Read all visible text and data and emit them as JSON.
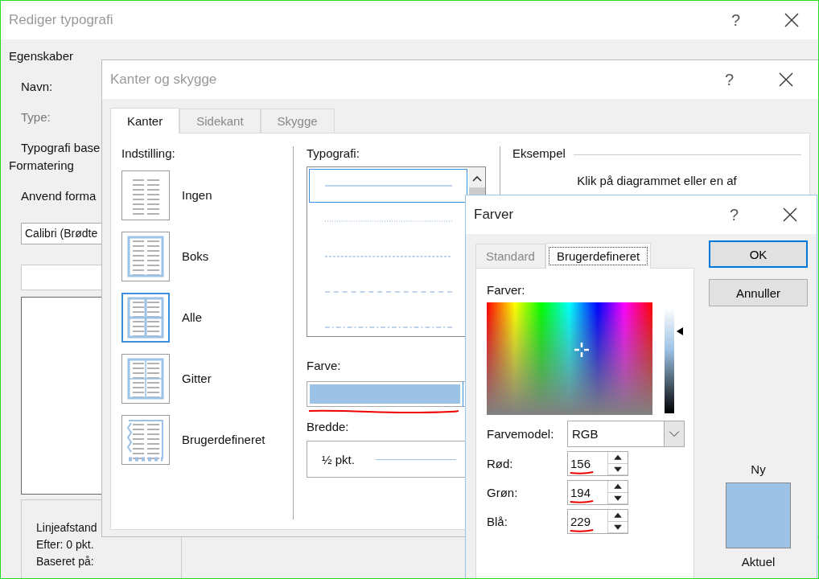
{
  "style_window": {
    "title": "Rediger typografi",
    "help": "?",
    "properties_heading": "Egenskaber",
    "fields": [
      {
        "label": "Navn:",
        "disabled": false
      },
      {
        "label": "Type:",
        "disabled": true
      },
      {
        "label": "Typografi base",
        "disabled": false
      }
    ],
    "formatting_heading": "Formatering",
    "apply_label": "Anvend forma",
    "font_select": "Calibri (Brødte",
    "description_lines": [
      "Linjeafstand",
      "Efter:  0 pkt.",
      "Baseret på:"
    ]
  },
  "borders_window": {
    "title": "Kanter og skygge",
    "help": "?",
    "tabs": [
      {
        "label": "Kanter",
        "selected": true
      },
      {
        "label": "Sidekant",
        "selected": false
      },
      {
        "label": "Skygge",
        "selected": false
      }
    ],
    "setting_heading": "Indstilling:",
    "presets": [
      {
        "kind": "none",
        "label": "Ingen",
        "selected": false
      },
      {
        "kind": "box",
        "label": "Boks",
        "selected": false
      },
      {
        "kind": "all",
        "label": "Alle",
        "selected": true
      },
      {
        "kind": "grid",
        "label": "Gitter",
        "selected": false
      },
      {
        "kind": "custom",
        "label": "Brugerdefineret",
        "selected": false
      }
    ],
    "style_heading": "Typografi:",
    "line_styles": [
      {
        "kind": "solid",
        "selected": true
      },
      {
        "kind": "dotted",
        "selected": false
      },
      {
        "kind": "dashed",
        "selected": false
      },
      {
        "kind": "long-dashed",
        "selected": false
      },
      {
        "kind": "dash-dot",
        "selected": false
      }
    ],
    "color_label": "Farve:",
    "width_label": "Bredde:",
    "width_value": "½ pkt.",
    "preview_heading": "Eksempel",
    "preview_hint": "Klik på diagrammet eller en af"
  },
  "colors_window": {
    "title": "Farver",
    "help": "?",
    "tabs": [
      {
        "label": "Standard",
        "selected": false
      },
      {
        "label": "Brugerdefineret",
        "selected": true
      }
    ],
    "colors_label": "Farver:",
    "luminance": {
      "level": 0.77
    },
    "model_label": "Farvemodel:",
    "model_value": "RGB",
    "channels": [
      {
        "label": "Rød:",
        "value": "156"
      },
      {
        "label": "Grøn:",
        "value": "194"
      },
      {
        "label": "Blå:",
        "value": "229"
      }
    ],
    "buttons": [
      {
        "label": "OK",
        "default": true
      },
      {
        "label": "Annuller",
        "default": false
      }
    ],
    "new_label": "Ny",
    "current_label": "Aktuel"
  }
}
